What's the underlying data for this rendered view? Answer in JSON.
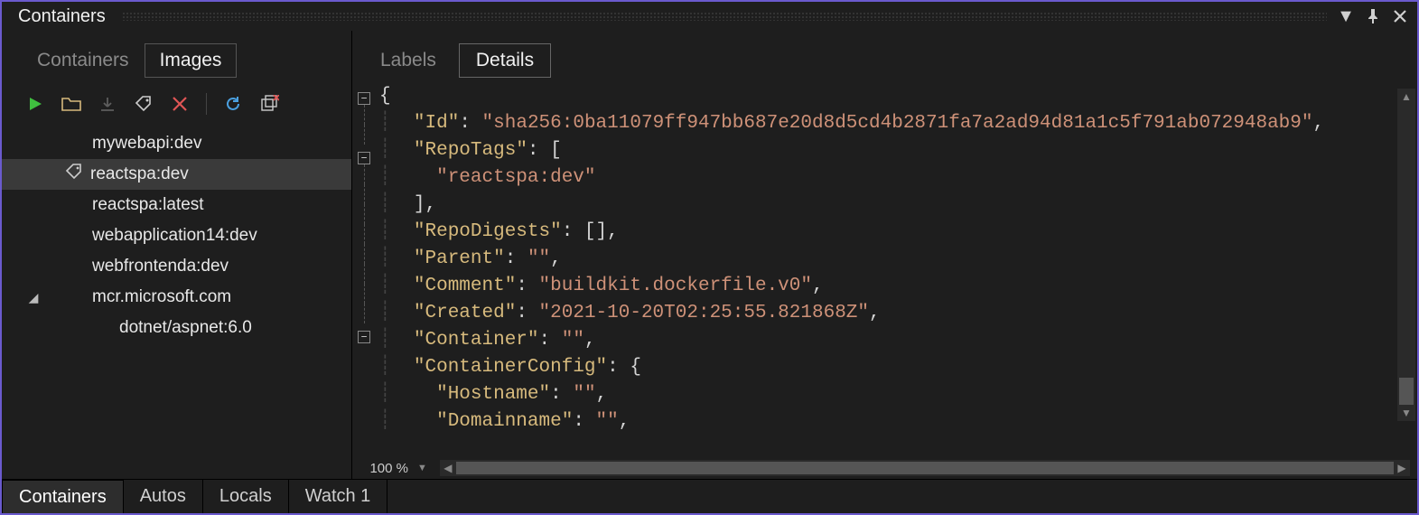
{
  "window": {
    "title": "Containers"
  },
  "leftTabs": {
    "containers": "Containers",
    "images": "Images",
    "active": "images"
  },
  "tree": {
    "items": [
      {
        "label": "mywebapi:dev",
        "depth": 1,
        "selected": false
      },
      {
        "label": "reactspa:dev",
        "depth": 1,
        "selected": true,
        "tagged": true
      },
      {
        "label": "reactspa:latest",
        "depth": 1,
        "selected": false
      },
      {
        "label": "webapplication14:dev",
        "depth": 1,
        "selected": false
      },
      {
        "label": "webfrontenda:dev",
        "depth": 1,
        "selected": false
      },
      {
        "label": "mcr.microsoft.com",
        "depth": 1,
        "selected": false,
        "expander": "open"
      },
      {
        "label": "dotnet/aspnet:6.0",
        "depth": 2,
        "selected": false
      }
    ]
  },
  "rightTabs": {
    "labels": "Labels",
    "details": "Details",
    "active": "details"
  },
  "zoom": "100 %",
  "json": {
    "Id": "sha256:0ba11079ff947bb687e20d8d5cd4b2871fa7a2ad94d81a1c5f791ab072948ab9",
    "RepoTags": [
      "reactspa:dev"
    ],
    "RepoDigests_empty": "[]",
    "Parent": "",
    "Comment": "buildkit.dockerfile.v0",
    "Created": "2021-10-20T02:25:55.821868Z",
    "Container": "",
    "ContainerConfig": {
      "Hostname": "",
      "Domainname": ""
    }
  },
  "keys": {
    "Id": "Id",
    "RepoTags": "RepoTags",
    "RepoDigests": "RepoDigests",
    "Parent": "Parent",
    "Comment": "Comment",
    "Created": "Created",
    "Container": "Container",
    "ContainerConfig": "ContainerConfig",
    "Hostname": "Hostname",
    "Domainname": "Domainname"
  },
  "bottomTabs": {
    "items": [
      "Containers",
      "Autos",
      "Locals",
      "Watch 1"
    ],
    "active": 0
  }
}
